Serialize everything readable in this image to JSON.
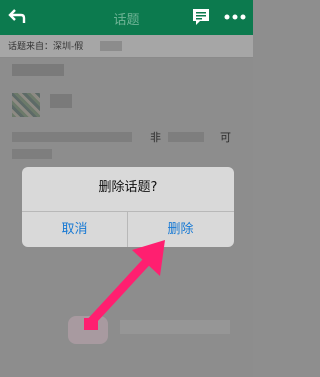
{
  "header": {
    "back_icon": "back-arrow-icon",
    "title": "话题",
    "chat_icon": "chat-bubble-icon",
    "more_icon": "more-dots-icon"
  },
  "source": {
    "text": "话题来自：深圳-假"
  },
  "content": {
    "fragment_right": "非",
    "fragment_end": "可"
  },
  "dialog": {
    "title": "删除话题?",
    "cancel_label": "取消",
    "confirm_label": "删除"
  },
  "colors": {
    "header_bg": "#0c7a4e",
    "dialog_button": "#1779d4",
    "arrow": "#ff1f70"
  }
}
